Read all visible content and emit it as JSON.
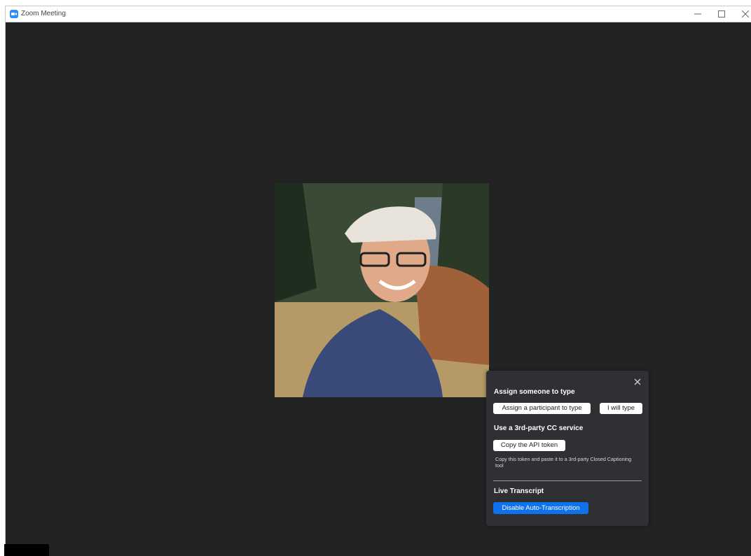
{
  "window": {
    "title": "Zoom Meeting"
  },
  "closed_captions_panel": {
    "assign_heading": "Assign someone to type",
    "assign_participant_label": "Assign a participant to type",
    "i_will_type_label": "I will type",
    "third_party_heading": "Use a 3rd-party CC service",
    "copy_api_token_label": "Copy the API token",
    "copy_token_note": "Copy this token and paste it to a 3rd-party Closed Captioning tool",
    "live_transcript_heading": "Live Transcript",
    "disable_auto_transcription_label": "Disable Auto-Transcription"
  },
  "colors": {
    "meeting_background": "#232323",
    "panel_background": "#303034",
    "primary_button": "#0e72ed",
    "app_icon": "#2d8cff"
  },
  "icons": [
    "zoom-app-icon",
    "minimize-icon",
    "maximize-icon",
    "close-icon",
    "panel-close-icon"
  ]
}
